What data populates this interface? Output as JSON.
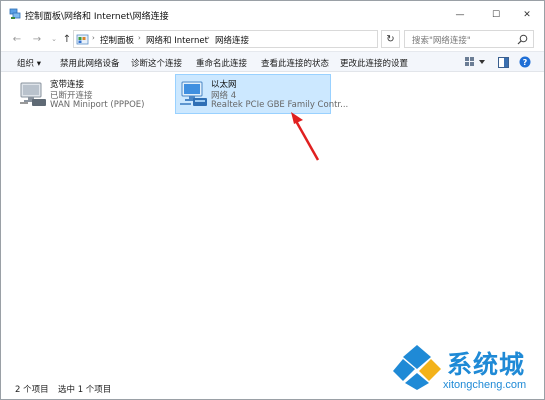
{
  "window": {
    "title": "控制面板\\网络和 Internet\\网络连接"
  },
  "titlebar_buttons": {
    "minimize": "—",
    "maximize": "☐",
    "close": "✕"
  },
  "address": {
    "back": "←",
    "forward": "→",
    "recent": "⌄",
    "up": "↑",
    "crumbs": [
      "控制面板",
      "网络和 Internet",
      "网络连接"
    ],
    "separator": "›",
    "dropdown": "⌄",
    "refresh": "↻"
  },
  "search": {
    "placeholder": "搜索\"网络连接\""
  },
  "commands": {
    "organize": "组织 ▾",
    "disable_device": "禁用此网络设备",
    "diagnose": "诊断这个连接",
    "rename": "重命名此连接",
    "view_status": "查看此连接的状态",
    "change_settings": "更改此连接的设置"
  },
  "connections": [
    {
      "name": "宽带连接",
      "status": "已断开连接",
      "device": "WAN Miniport (PPPOE)",
      "selected": false
    },
    {
      "name": "以太网",
      "status": "网络 4",
      "device": "Realtek PCIe GBE Family Contr...",
      "selected": true
    }
  ],
  "statusbar": {
    "item_count": "2 个项目",
    "selected_count": "选中 1 个项目"
  },
  "watermark": {
    "brand": "系统城",
    "url": "xitongcheng.com"
  },
  "colors": {
    "selection_bg": "#cce8ff",
    "selection_border": "#99d1ff",
    "accent_blue": "#1f8ad6",
    "help_blue": "#1f6fd6",
    "arrow_red": "#e02020"
  },
  "icons": {
    "title": "network-connections-icon",
    "breadcrumb": "control-panel-icon",
    "search": "search-icon",
    "help": "help-icon",
    "views": "change-view-icon",
    "preview": "preview-pane-icon"
  }
}
